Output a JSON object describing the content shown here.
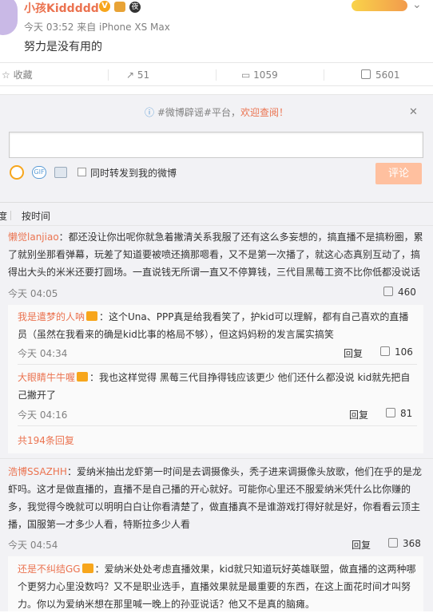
{
  "post": {
    "username": "小孩Kiddddd",
    "verified_badge": "V",
    "night_badge": "夜",
    "meta": "今天 03:52 来自 iPhone XS Max",
    "content": "努力是没有用的"
  },
  "actions": {
    "favorite": "收藏",
    "repost": "51",
    "comment": "1059",
    "like": "5601"
  },
  "notice": {
    "prefix": "#微博辟谣#平台，",
    "highlight": "欢迎查阅！"
  },
  "composer": {
    "gif_label": "GIF",
    "repost_label": "同时转发到我的微博",
    "submit_label": "评论"
  },
  "sort": {
    "label1": "度",
    "label2": "按时间"
  },
  "comments": [
    {
      "name": "懒觉lanjiao",
      "text": "：都还没让你出呢你就急着撇清关系我服了还有这么多妄想的，搞直播不是搞粉圈，累了就别坐那看弹幕，玩差了知道要被喷还摘那嗯看，又不是第一次播了，就这心态真别互动了，搞得出大头的米米还要打圆场。一直说钱无所谓一直又不停算钱，三代目黑莓工资不比你低都没说话",
      "time": "今天 04:05",
      "likes": "460",
      "replies": [
        {
          "name": "我是遣梦的人呐",
          "text": "：这个Una、PPP真是给我看笑了，护kid可以理解，都有自己喜欢的直播员（虽然在我看来的确是kid比事的格局不够），但这妈妈粉的发言属实搞笑",
          "time": "今天 04:34",
          "reply": "回复",
          "likes": "106"
        },
        {
          "name": "大眼睛牛牛喔",
          "text": "：我也这样觉得 黑莓三代目挣得钱应该更少 他们还什么都没说 kid就先把自己撇开了",
          "time": "今天 04:16",
          "reply": "回复",
          "likes": "81"
        }
      ],
      "more": "共194条回复"
    },
    {
      "name": "浩博SSAZHH",
      "text": "：爱纳米抽出龙虾第一时间是去调摄像头，秃子进来调摄像头放歌，他们在乎的是龙虾吗。这才是做直播的，直播不是自己播的开心就好。可能你心里还不服爱纳米凭什么比你赚的多，我觉得今晚就可以明明白白让你看清楚了，做直播真不是谁游戏打得好就是好，你看看云顶主播，国服第一才多少人看，特斯拉多少人看",
      "time": "今天 04:54",
      "reply": "回复",
      "likes": "368",
      "replies": [
        {
          "name": "还是不纠结GG",
          "text": "：爱纳米处处考虑直播效果，kid就只知道玩好英雄联盟，做直播的这两种哪个更努力心里没数吗？又不是职业选手，直播效果就是最重要的东西，在这上面花时间才叫努力。你以为爱纳米想在那里喊一晚上的孙亚说话？他又不是真的脑瘫。"
        }
      ]
    }
  ]
}
